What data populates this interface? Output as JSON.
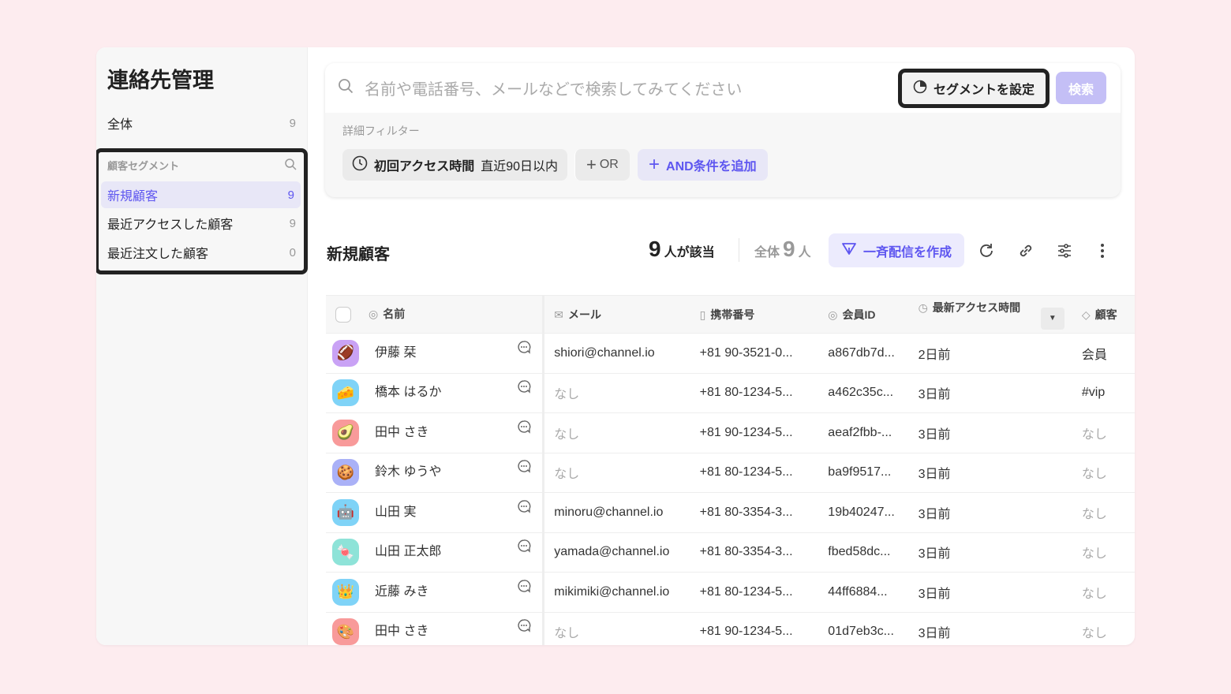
{
  "sidebar": {
    "title": "連絡先管理",
    "all": {
      "label": "全体",
      "count": "9"
    },
    "segment_header": "顧客セグメント",
    "segments": [
      {
        "label": "新規顧客",
        "count": "9",
        "active": true
      },
      {
        "label": "最近アクセスした顧客",
        "count": "9"
      },
      {
        "label": "最近注文した顧客",
        "count": "0"
      }
    ]
  },
  "search": {
    "placeholder": "名前や電話番号、メールなどで検索してみてください",
    "segment_button": "セグメントを設定",
    "search_button": "検索",
    "filter_label": "詳細フィルター",
    "filter": {
      "field": "初回アクセス時間",
      "value": "直近90日以内"
    },
    "or_label": "OR",
    "and_label": "AND条件を追加"
  },
  "toolbar": {
    "title": "新規顧客",
    "match_count": "9",
    "match_suffix": "人が該当",
    "total_prefix": "全体",
    "total_count": "9",
    "total_suffix": "人",
    "broadcast_label": "一斉配信を作成"
  },
  "colors": {
    "accent": "#5e56f0",
    "background": "#fdecef"
  },
  "table": {
    "headers": [
      "名前",
      "メール",
      "携帯番号",
      "会員ID",
      "最新アクセス時間",
      "顧客"
    ],
    "rows": [
      {
        "emoji": "🏈",
        "bg": "#c9a2f5",
        "name": "伊藤 栞",
        "email": "shiori@channel.io",
        "phone": "+81 90-3521-0...",
        "id": "a867db7d...",
        "access": "2日前",
        "tag": "会員"
      },
      {
        "emoji": "🧀",
        "bg": "#7fd3f7",
        "name": "橋本 はるか",
        "email": "なし",
        "phone": "+81 80-1234-5...",
        "id": "a462c35c...",
        "access": "3日前",
        "tag": "#vip"
      },
      {
        "emoji": "🥑",
        "bg": "#f89a9a",
        "name": "田中 さき",
        "email": "なし",
        "phone": "+81 90-1234-5...",
        "id": "aeaf2fbb-...",
        "access": "3日前",
        "tag": "なし"
      },
      {
        "emoji": "🍪",
        "bg": "#aab1f7",
        "name": "鈴木 ゆうや",
        "email": "なし",
        "phone": "+81 80-1234-5...",
        "id": "ba9f9517...",
        "access": "3日前",
        "tag": "なし"
      },
      {
        "emoji": "🤖",
        "bg": "#7fd3f7",
        "name": "山田 実",
        "email": "minoru@channel.io",
        "phone": "+81 80-3354-3...",
        "id": "19b40247...",
        "access": "3日前",
        "tag": "なし"
      },
      {
        "emoji": "🍬",
        "bg": "#8ee3d8",
        "name": "山田 正太郎",
        "email": "yamada@channel.io",
        "phone": "+81 80-3354-3...",
        "id": "fbed58dc...",
        "access": "3日前",
        "tag": "なし"
      },
      {
        "emoji": "👑",
        "bg": "#7fd3f7",
        "name": "近藤 みき",
        "email": "mikimiki@channel.io",
        "phone": "+81 80-1234-5...",
        "id": "44ff6884...",
        "access": "3日前",
        "tag": "なし"
      },
      {
        "emoji": "🎨",
        "bg": "#f89a9a",
        "name": "田中 さき",
        "email": "なし",
        "phone": "+81 90-1234-5...",
        "id": "01d7eb3c...",
        "access": "3日前",
        "tag": "なし"
      }
    ]
  }
}
